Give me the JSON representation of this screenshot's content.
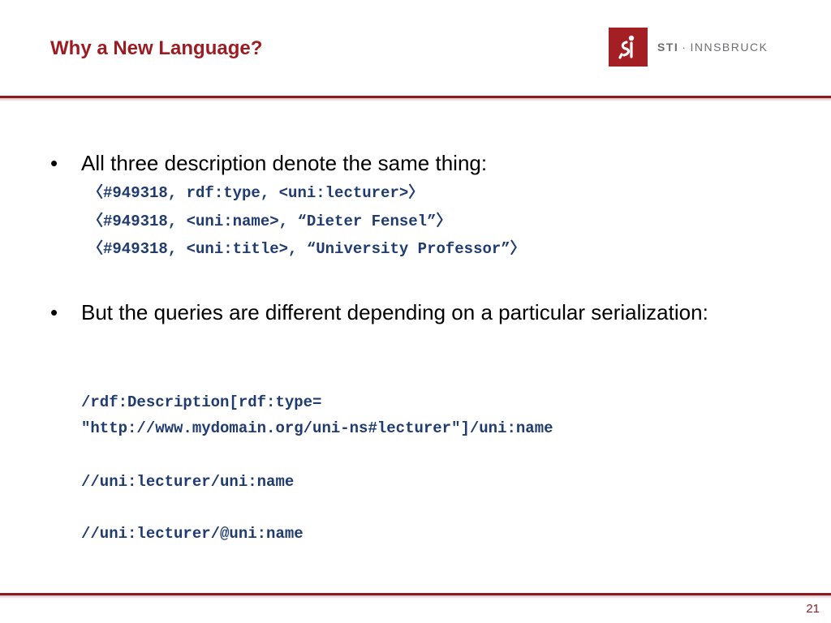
{
  "slide": {
    "title": "Why a New Language?",
    "page_number": "21"
  },
  "logo": {
    "brand": "STI",
    "separator": "·",
    "name": "INNSBRUCK",
    "box_color": "#a31f24"
  },
  "bullets": [
    {
      "mark": "•",
      "text": "All three description denote the same thing:",
      "code_lines": [
        "〈#949318, rdf:type, <uni:lecturer>〉",
        "〈#949318, <uni:name>, “Dieter Fensel”〉",
        "〈#949318, <uni:title>, “University Professor”〉"
      ]
    },
    {
      "mark": "•",
      "text": "But the queries are different depending on a particular serialization:",
      "code_lines": [
        "/rdf:Description[rdf:type=",
        "\"http://www.mydomain.org/uni-ns#lecturer\"]/uni:name",
        "//uni:lecturer/uni:name",
        "//uni:lecturer/@uni:name"
      ]
    }
  ],
  "colors": {
    "title": "#9b1c22",
    "rule": "#8c1b1f",
    "code": "#1f3b70"
  }
}
